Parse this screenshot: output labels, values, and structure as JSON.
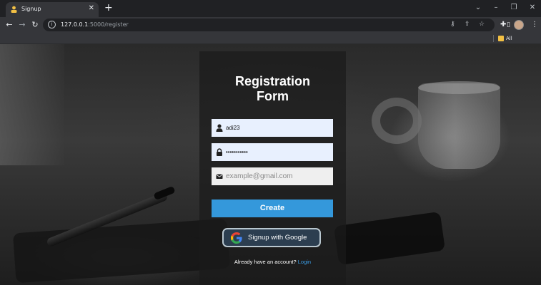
{
  "browser": {
    "tab_title": "Signup",
    "url_host": "127.0.0.1",
    "url_path": ":5000/register",
    "bookmarks_label": "All Bookmarks"
  },
  "form": {
    "title_line1": "Registration",
    "title_line2": "Form",
    "username_value": "adi23",
    "password_value": "password1!!",
    "email_placeholder": "example@gmail.com",
    "create_label": "Create",
    "google_label": "Signup with Google",
    "login_prompt": "Already have an account?",
    "login_link": "Login"
  },
  "colors": {
    "create_button": "#3498db",
    "google_button": "#2c3e50",
    "autofill_field": "#e8f0fe",
    "login_link": "#3b9de6"
  },
  "icons": {
    "username": "user-icon",
    "password": "lock-icon",
    "email": "envelope-icon",
    "google": "google-logo"
  }
}
